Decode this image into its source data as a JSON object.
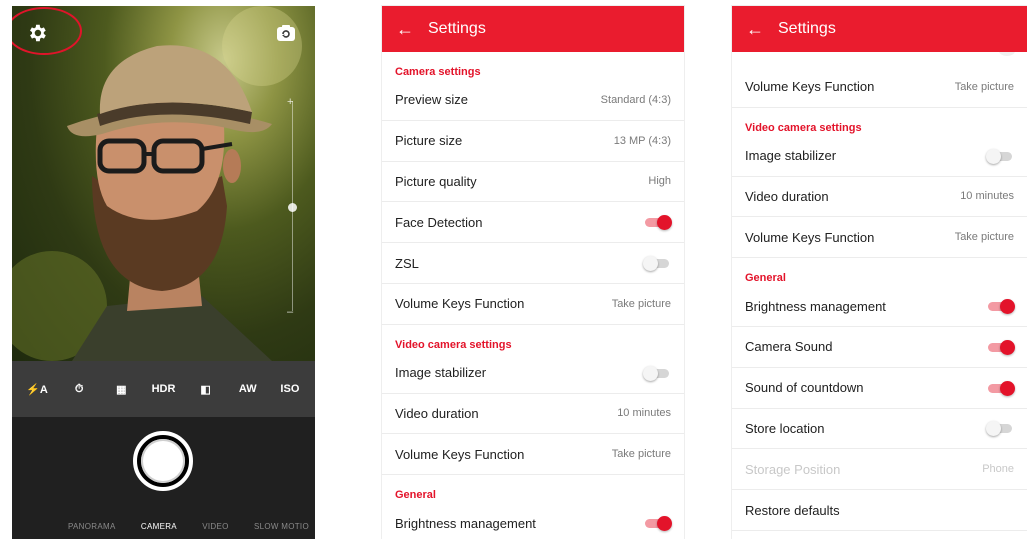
{
  "camera": {
    "modes": [
      "PANORAMA",
      "CAMERA",
      "VIDEO",
      "SLOW MOTIO"
    ],
    "active_mode": "CAMERA",
    "toolbar": [
      {
        "icon": "flash-auto-icon",
        "glyph": "⚡A"
      },
      {
        "icon": "timer-icon",
        "glyph": "⏱"
      },
      {
        "icon": "grid-icon",
        "glyph": "▦"
      },
      {
        "icon": "hdr-icon",
        "glyph": "HDR"
      },
      {
        "icon": "white-balance-icon",
        "glyph": "◧"
      },
      {
        "icon": "auto-white-icon",
        "glyph": "AW"
      },
      {
        "icon": "iso-auto-icon",
        "glyph": "ISO"
      }
    ],
    "accent_color": "#e0142a"
  },
  "settings_a": {
    "title": "Settings",
    "sections": [
      {
        "header": "Camera settings",
        "rows": [
          {
            "label": "Preview size",
            "value": "Standard (4:3)"
          },
          {
            "label": "Picture size",
            "value": "13 MP (4:3)"
          },
          {
            "label": "Picture quality",
            "value": "High"
          },
          {
            "label": "Face Detection",
            "toggle": true
          },
          {
            "label": "ZSL",
            "toggle": false
          },
          {
            "label": "Volume Keys Function",
            "value": "Take picture"
          }
        ]
      },
      {
        "header": "Video camera settings",
        "rows": [
          {
            "label": "Image stabilizer",
            "toggle": false
          },
          {
            "label": "Video duration",
            "value": "10 minutes"
          },
          {
            "label": "Volume Keys Function",
            "value": "Take picture"
          }
        ]
      },
      {
        "header": "General",
        "rows": [
          {
            "label": "Brightness management",
            "toggle": true
          }
        ]
      }
    ]
  },
  "settings_b": {
    "title": "Settings",
    "sections": [
      {
        "header": "",
        "rows": [
          {
            "label": "Volume Keys Function",
            "value": "Take picture"
          }
        ]
      },
      {
        "header": "Video camera settings",
        "rows": [
          {
            "label": "Image stabilizer",
            "toggle": false
          },
          {
            "label": "Video duration",
            "value": "10 minutes"
          },
          {
            "label": "Volume Keys Function",
            "value": "Take picture"
          }
        ]
      },
      {
        "header": "General",
        "rows": [
          {
            "label": "Brightness management",
            "toggle": true
          },
          {
            "label": "Camera Sound",
            "toggle": true
          },
          {
            "label": "Sound of countdown",
            "toggle": true
          },
          {
            "label": "Store location",
            "toggle": false
          },
          {
            "label": "Storage Position",
            "value": "Phone",
            "disabled": true
          },
          {
            "label": "Restore defaults"
          }
        ]
      }
    ]
  },
  "colors": {
    "appbar": "#ea1c2e",
    "section_header": "#e3132a"
  }
}
